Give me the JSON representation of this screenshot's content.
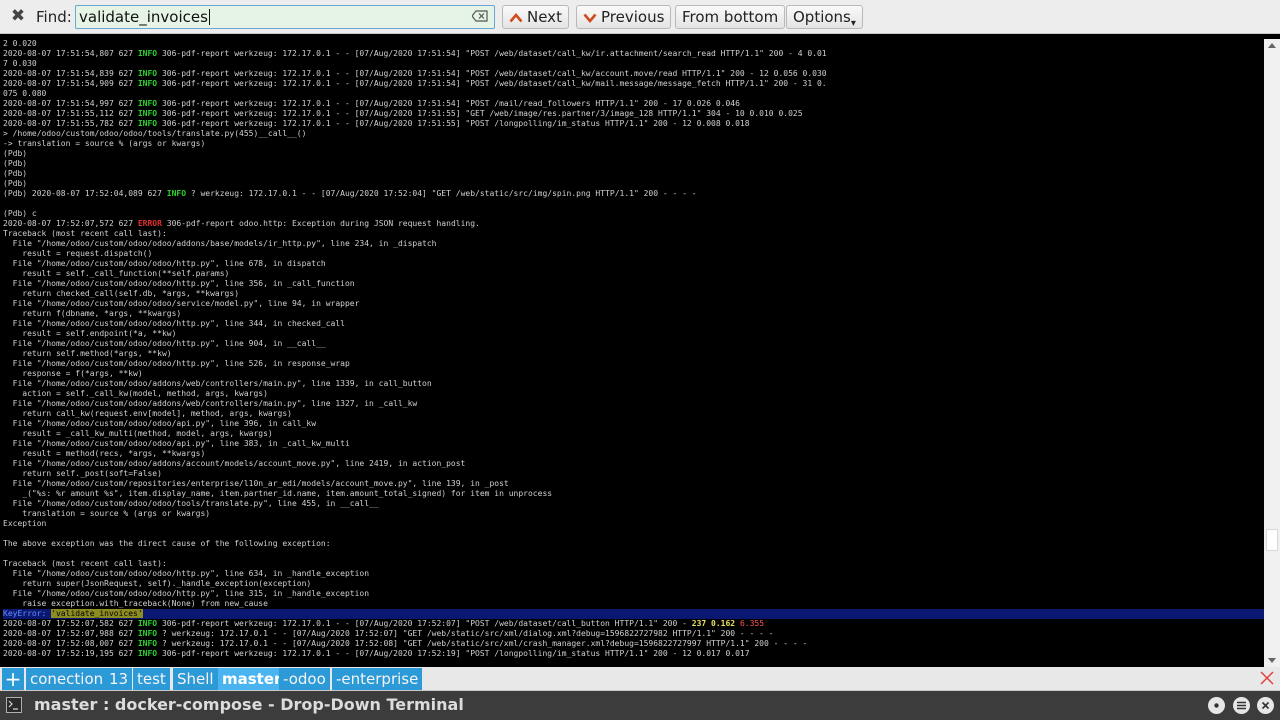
{
  "find_bar": {
    "label": "Find:",
    "query": "validate_invoices",
    "next_label": "Next",
    "previous_label": "Previous",
    "from_bottom_label": "From bottom",
    "options_label": "Options"
  },
  "terminal": {
    "lines_before": [
      "2 0.020",
      "2020-08-07 17:51:54,807 627 |INFO| 306-pdf-report werkzeug: 172.17.0.1 - - [07/Aug/2020 17:51:54] \"POST /web/dataset/call_kw/ir.attachment/search_read HTTP/1.1\" 200 - 4 0.01",
      "7 0.030",
      "2020-08-07 17:51:54,839 627 |INFO| 306-pdf-report werkzeug: 172.17.0.1 - - [07/Aug/2020 17:51:54] \"POST /web/dataset/call_kw/account.move/read HTTP/1.1\" 200 - 12 0.056 0.030",
      "2020-08-07 17:51:54,909 627 |INFO| 306-pdf-report werkzeug: 172.17.0.1 - - [07/Aug/2020 17:51:54] \"POST /web/dataset/call_kw/mail.message/message_fetch HTTP/1.1\" 200 - 31 0.",
      "075 0.080",
      "2020-08-07 17:51:54,997 627 |INFO| 306-pdf-report werkzeug: 172.17.0.1 - - [07/Aug/2020 17:51:54] \"POST /mail/read_followers HTTP/1.1\" 200 - 17 0.026 0.046",
      "2020-08-07 17:51:55,112 627 |INFO| 306-pdf-report werkzeug: 172.17.0.1 - - [07/Aug/2020 17:51:55] \"GET /web/image/res.partner/3/image_128 HTTP/1.1\" 304 - 10 0.010 0.025",
      "2020-08-07 17:51:55,782 627 |INFO| 306-pdf-report werkzeug: 172.17.0.1 - - [07/Aug/2020 17:51:55] \"POST /longpolling/im_status HTTP/1.1\" 200 - 12 0.008 0.018",
      "> /home/odoo/custom/odoo/odoo/tools/translate.py(455)__call__()",
      "-> translation = source % (args or kwargs)",
      "(Pdb)",
      "(Pdb)",
      "(Pdb)",
      "(Pdb)",
      "(Pdb) 2020-08-07 17:52:04,089 627 |INFO| ? werkzeug: 172.17.0.1 - - [07/Aug/2020 17:52:04] \"GET /web/static/src/img/spin.png HTTP/1.1\" 200 - - - -",
      "",
      "(Pdb) c",
      "2020-08-07 17:52:07,572 627 |ERROR| 306-pdf-report odoo.http: Exception during JSON request handling.",
      "Traceback (most recent call last):",
      "  File \"/home/odoo/custom/odoo/odoo/addons/base/models/ir_http.py\", line 234, in _dispatch",
      "    result = request.dispatch()",
      "  File \"/home/odoo/custom/odoo/odoo/http.py\", line 678, in dispatch",
      "    result = self._call_function(**self.params)",
      "  File \"/home/odoo/custom/odoo/odoo/http.py\", line 356, in _call_function",
      "    return checked_call(self.db, *args, **kwargs)",
      "  File \"/home/odoo/custom/odoo/odoo/service/model.py\", line 94, in wrapper",
      "    return f(dbname, *args, **kwargs)",
      "  File \"/home/odoo/custom/odoo/odoo/http.py\", line 344, in checked_call",
      "    result = self.endpoint(*a, **kw)",
      "  File \"/home/odoo/custom/odoo/odoo/http.py\", line 904, in __call__",
      "    return self.method(*args, **kw)",
      "  File \"/home/odoo/custom/odoo/odoo/http.py\", line 526, in response_wrap",
      "    response = f(*args, **kw)",
      "  File \"/home/odoo/custom/odoo/addons/web/controllers/main.py\", line 1339, in call_button",
      "    action = self._call_kw(model, method, args, kwargs)",
      "  File \"/home/odoo/custom/odoo/addons/web/controllers/main.py\", line 1327, in _call_kw",
      "    return call_kw(request.env[model], method, args, kwargs)",
      "  File \"/home/odoo/custom/odoo/odoo/api.py\", line 396, in call_kw",
      "    result = _call_kw_multi(method, model, args, kwargs)",
      "  File \"/home/odoo/custom/odoo/odoo/api.py\", line 383, in _call_kw_multi",
      "    result = method(recs, *args, **kwargs)",
      "  File \"/home/odoo/custom/odoo/addons/account/models/account_move.py\", line 2419, in action_post",
      "    return self._post(soft=False)",
      "  File \"/home/odoo/custom/repositories/enterprise/l10n_ar_edi/models/account_move.py\", line 139, in _post",
      "    _(\"%s: %r amount %s\", item.display_name, item.partner_id.name, item.amount_total_signed) for item in unprocess",
      "  File \"/home/odoo/custom/odoo/odoo/tools/translate.py\", line 455, in __call__",
      "    translation = source % (args or kwargs)",
      "Exception",
      "",
      "The above exception was the direct cause of the following exception:",
      "",
      "Traceback (most recent call last):",
      "  File \"/home/odoo/custom/odoo/odoo/http.py\", line 634, in _handle_exception",
      "    return super(JsonRequest, self)._handle_exception(exception)",
      "  File \"/home/odoo/custom/odoo/odoo/http.py\", line 315, in _handle_exception",
      "    raise exception.with_traceback(None) from new_cause"
    ],
    "match_line": {
      "prefix": "KeyError: ",
      "match": "'validate_invoices'"
    },
    "lines_after": [
      "2020-08-07 17:52:07,582 627 |INFO| 306-pdf-report werkzeug: 172.17.0.1 - - [07/Aug/2020 17:52:07] \"POST /web/dataset/call_button HTTP/1.1\" 200 - |Y|237| |Y|0.162| |R|6.355|",
      "2020-08-07 17:52:07,988 627 |INFO| ? werkzeug: 172.17.0.1 - - [07/Aug/2020 17:52:07] \"GET /web/static/src/xml/dialog.xml?debug=1596822727982 HTTP/1.1\" 200 - - - -",
      "2020-08-07 17:52:08,007 627 |INFO| ? werkzeug: 172.17.0.1 - - [07/Aug/2020 17:52:08] \"GET /web/static/src/xml/crash_manager.xml?debug=1596822727997 HTTP/1.1\" 200 - - - -",
      "2020-08-07 17:52:19,195 627 |INFO| 306-pdf-report werkzeug: 172.17.0.1 - - [07/Aug/2020 17:52:19] \"POST /longpolling/im_status HTTP/1.1\" 200 - 12 0.017 0.017"
    ]
  },
  "tabs": [
    {
      "label": "conection"
    },
    {
      "label": "13"
    },
    {
      "label": "test"
    },
    {
      "label": "Shell"
    },
    {
      "label": "master",
      "active": true
    },
    {
      "label": "-odoo"
    },
    {
      "label": "-enterprise"
    }
  ],
  "title_bar": {
    "title": "master : docker-compose - Drop-Down Terminal"
  },
  "colors": {
    "tab_bg": "#2d9ad8",
    "tab_active_bg": "#49b4f0",
    "info": "#2bd12b",
    "error": "#e03030",
    "highlight_line": "#0a1872",
    "match_bg": "#8c8c20"
  }
}
